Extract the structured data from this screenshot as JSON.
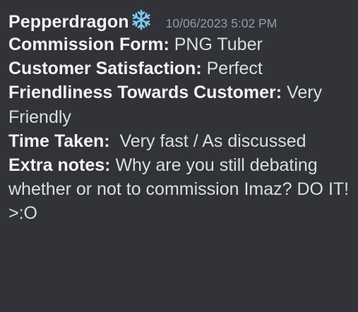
{
  "message": {
    "username": "Pepperdragon",
    "role_icon": "snowflake-icon",
    "timestamp": "10/06/2023 5:02 PM",
    "fields": [
      {
        "label": "Commission Form:",
        "value": "PNG Tuber"
      },
      {
        "label": "Customer Satisfaction:",
        "value": "Perfect"
      },
      {
        "label": "Friendliness Towards Customer:",
        "value": "Very Friendly"
      },
      {
        "label": "Time Taken:",
        "value": "Very fast / As discussed"
      },
      {
        "label": "Extra notes:",
        "value": "Why are you still debating whether or not to commission Imaz? DO IT! >:O"
      }
    ]
  },
  "colors": {
    "background": "#313338",
    "username": "#f2f3f5",
    "timestamp": "#949ba4",
    "text": "#dbdee1",
    "snowflake": "#7ec8f5"
  }
}
